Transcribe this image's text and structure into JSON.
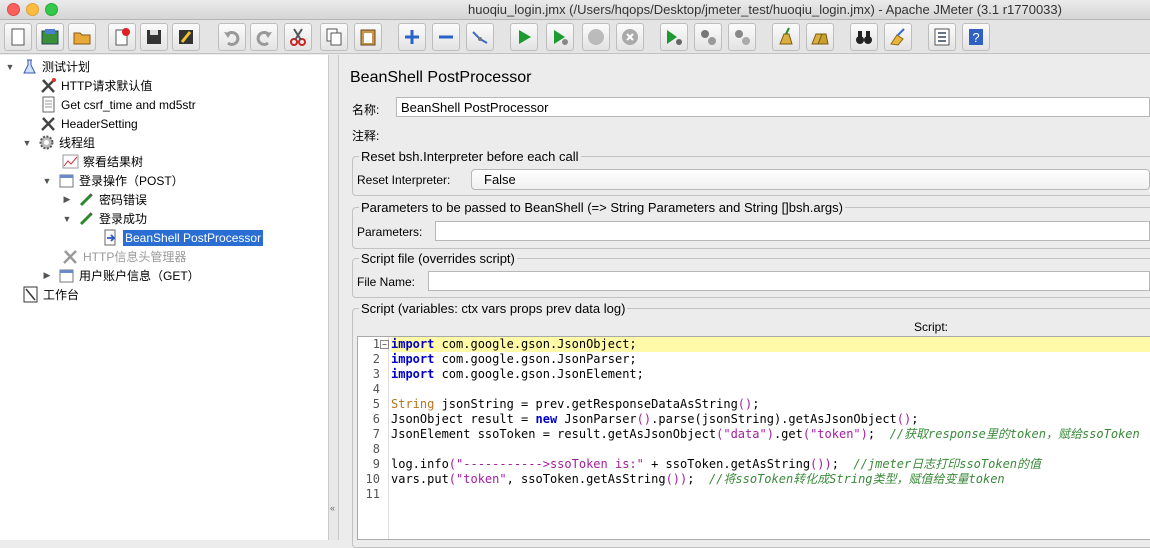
{
  "window": {
    "title": "huoqiu_login.jmx (/Users/hqops/Desktop/jmeter_test/huoqiu_login.jmx) - Apache JMeter (3.1 r1770033)"
  },
  "toolbar": {
    "buttons": [
      "new",
      "templates",
      "open",
      "close",
      "save",
      "save-as",
      "undo",
      "redo",
      "cut",
      "copy",
      "paste",
      "expand",
      "collapse",
      "toggle",
      "start",
      "start-no-pauses",
      "stop",
      "shutdown",
      "remote-start",
      "remote-stop",
      "remote-exit",
      "clear",
      "clear-all",
      "search",
      "reset-search",
      "function-helper",
      "help"
    ]
  },
  "tree": {
    "items": [
      {
        "label": "测试计划",
        "icon": "flask-icon"
      },
      {
        "label": "HTTP请求默认值",
        "icon": "wrench-icon"
      },
      {
        "label": "Get csrf_time and md5str",
        "icon": "document-icon"
      },
      {
        "label": "HeaderSetting",
        "icon": "wrench-icon"
      },
      {
        "label": "线程组",
        "icon": "gear-icon"
      },
      {
        "label": "察看结果树",
        "icon": "chart-icon"
      },
      {
        "label": "登录操作（POST）",
        "icon": "sampler-icon"
      },
      {
        "label": "密码错误",
        "icon": "pencil-icon"
      },
      {
        "label": "登录成功",
        "icon": "pencil-icon"
      },
      {
        "label": "BeanShell PostProcessor",
        "icon": "arrow-doc-icon"
      },
      {
        "label": "HTTP信息头管理器",
        "icon": "wrench-icon"
      },
      {
        "label": "用户账户信息（GET）",
        "icon": "sampler-icon"
      },
      {
        "label": "工作台",
        "icon": "workbench-icon"
      }
    ]
  },
  "panel": {
    "title": "BeanShell PostProcessor",
    "name_label": "名称:",
    "name_value": "BeanShell PostProcessor",
    "comment_label": "注释:",
    "comment_value": "",
    "reset_group": "Reset bsh.Interpreter before each call",
    "reset_label": "Reset Interpreter:",
    "reset_value": "False",
    "params_group": "Parameters to be passed to BeanShell (=> String Parameters and String []bsh.args)",
    "params_label": "Parameters:",
    "params_value": "",
    "file_group": "Script file (overrides script)",
    "file_label": "File Name:",
    "file_value": "",
    "script_group": "Script (variables: ctx vars props prev data log)",
    "script_label": "Script:"
  },
  "script": {
    "lines": [
      "1",
      "2",
      "3",
      "4",
      "5",
      "6",
      "7",
      "8",
      "9",
      "10",
      "11"
    ],
    "code": {
      "l1a": "import",
      "l1b": " com.google.gson.JsonObject;",
      "l2a": "import",
      "l2b": " com.google.gson.JsonParser;",
      "l3a": "import",
      "l3b": " com.google.gson.JsonElement;",
      "l5a": "String",
      "l5b": " jsonString = prev.getResponseDataAsString",
      "l6a": "JsonObject result = ",
      "l6b": "new",
      "l6c": " JsonParser",
      "l6d": ".parse(jsonString).getAsJsonObject",
      "l7a": "JsonElement ssoToken = result.getAsJsonObject",
      "l7b": "\"data\"",
      "l7c": ".get",
      "l7d": "\"token\"",
      "l7e": "//获取response里的token，赋给ssoToken",
      "l9a": "log.info",
      "l9b": "\"----------->ssoToken is:\"",
      "l9c": " + ssoToken.getAsString",
      "l9d": "//jmeter日志打印ssoToken的值",
      "l10a": "vars.put",
      "l10b": "\"token\"",
      "l10c": ", ssoToken.getAsString",
      "l10d": "//将ssoToken转化成String类型，赋值给变量token"
    }
  },
  "colors": {
    "selection": "#2a6ed3",
    "keyword": "#0000c8",
    "comment": "#3a8a3a",
    "string": "#a11ea1",
    "current_line": "#fffaa8"
  }
}
